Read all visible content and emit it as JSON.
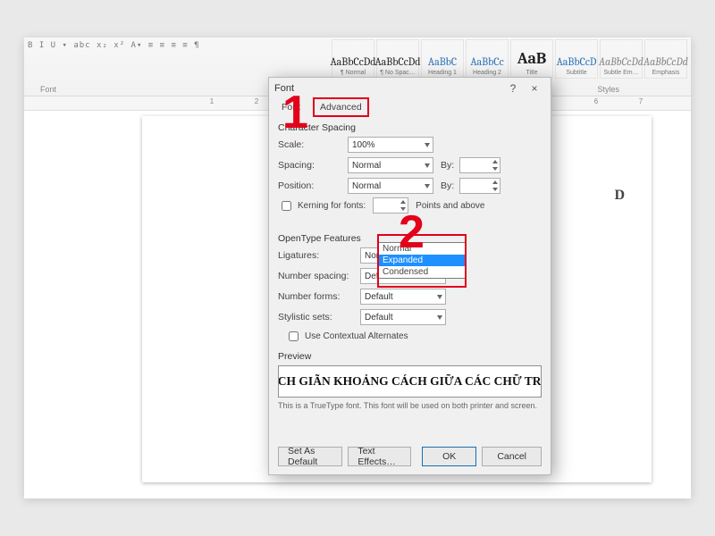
{
  "ribbon": {
    "font_section_label": "Font",
    "styles_section_label": "Styles",
    "styles": [
      {
        "sample": "AaBbCcDd",
        "label": "¶ Normal",
        "cls": "black"
      },
      {
        "sample": "AaBbCcDd",
        "label": "¶ No Spac…",
        "cls": "black"
      },
      {
        "sample": "AaBbC",
        "label": "Heading 1",
        "cls": ""
      },
      {
        "sample": "AaBbCc",
        "label": "Heading 2",
        "cls": ""
      },
      {
        "sample": "AaB",
        "label": "Title",
        "cls": "big"
      },
      {
        "sample": "AaBbCcD",
        "label": "Subtitle",
        "cls": ""
      },
      {
        "sample": "AaBbCcDd",
        "label": "Subtle Em…",
        "cls": "ital"
      },
      {
        "sample": "AaBbCcDd",
        "label": "Emphasis",
        "cls": "ital"
      }
    ]
  },
  "dialog": {
    "title": "Font",
    "tabs": {
      "font": "Font",
      "advanced": "Advanced"
    },
    "char_spacing": {
      "heading": "Character Spacing",
      "scale_label": "Scale:",
      "scale_value": "100%",
      "spacing_label": "Spacing:",
      "spacing_value": "Normal",
      "spacing_options": {
        "normal": "Normal",
        "expanded": "Expanded",
        "condensed": "Condensed"
      },
      "by_label": "By:",
      "position_label": "Position:",
      "position_value": "Normal",
      "kerning_label": "Kerning for fonts:",
      "kerning_suffix": "Points and above"
    },
    "opentype": {
      "heading": "OpenType Features",
      "ligatures_label": "Ligatures:",
      "ligatures_value": "None",
      "num_spacing_label": "Number spacing:",
      "num_spacing_value": "Default",
      "num_forms_label": "Number forms:",
      "num_forms_value": "Default",
      "stylistic_label": "Stylistic sets:",
      "stylistic_value": "Default",
      "contextual_label": "Use Contextual Alternates"
    },
    "preview": {
      "heading": "Preview",
      "text": "CÁCH GIÃN KHOẢNG CÁCH GIỮA CÁC CHỮ TRON",
      "hint": "This is a TrueType font. This font will be used on both printer and screen."
    },
    "buttons": {
      "set_default": "Set As Default",
      "text_effects": "Text Effects…",
      "ok": "OK",
      "cancel": "Cancel"
    },
    "help": "?",
    "close": "×"
  },
  "annotations": {
    "one": "1",
    "two": "2"
  },
  "doc_behind": "D"
}
